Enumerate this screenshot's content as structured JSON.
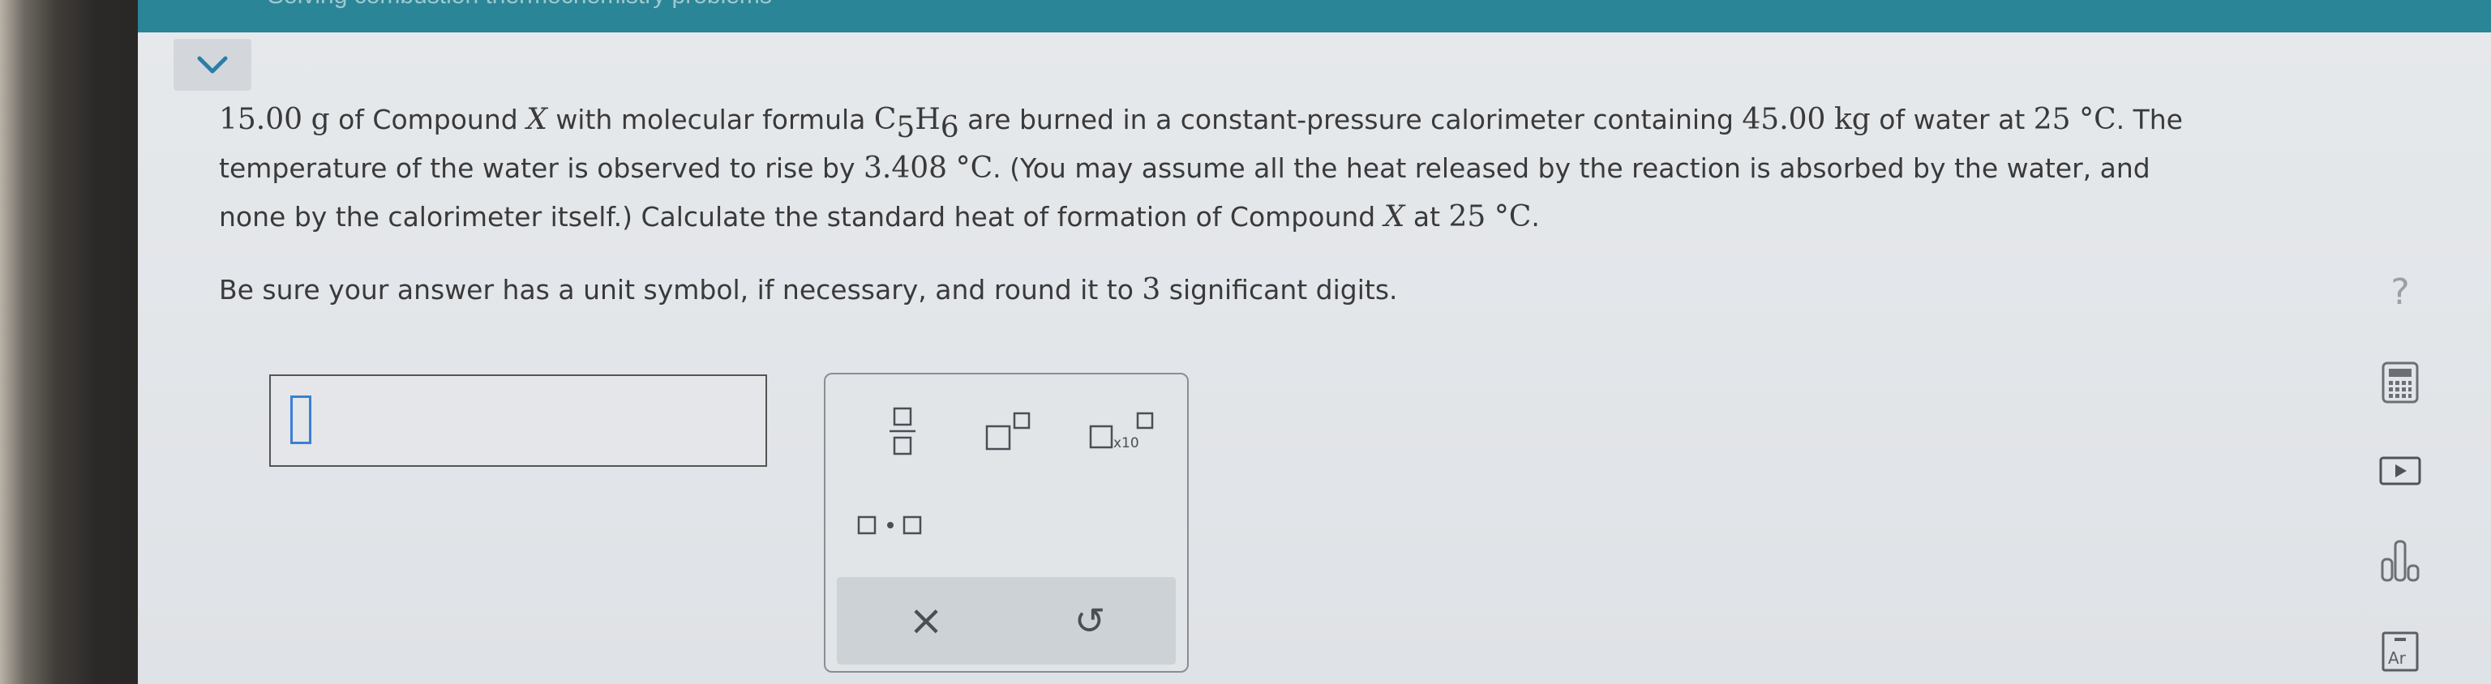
{
  "header": {
    "title": "Solving combustion thermochemistry problems"
  },
  "question": {
    "line1": {
      "mass": "15.00",
      "mass_unit": "g",
      "t1": " of Compound ",
      "compound_var": "X",
      "t2": " with molecular formula ",
      "formula_c": "C",
      "formula_c_sub": "5",
      "formula_h": "H",
      "formula_h_sub": "6",
      "t3": " are burned in a constant-pressure calorimeter containing ",
      "water_mass": "45.00",
      "water_unit": "kg",
      "t4": " of water at ",
      "temp": "25",
      "temp_unit": "°C",
      "t5": ". The"
    },
    "line2": {
      "t1": "temperature of the water is observed to rise by ",
      "rise": "3.408",
      "rise_unit": "°C",
      "t2": ". (You may assume all the heat released by the reaction is absorbed by the water, and"
    },
    "line3": {
      "t1": "none by the calorimeter itself.) Calculate the standard heat of formation of Compound ",
      "compound_var": "X",
      "t2": " at ",
      "temp": "25",
      "temp_unit": "°C",
      "t3": "."
    },
    "instruction": {
      "t1": "Be sure your answer has a unit symbol, if necessary, and round it to ",
      "digits": "3",
      "t2": " significant digits."
    }
  },
  "palette": {
    "x10_label": "x10",
    "clear_symbol": "×",
    "undo_symbol": "↺"
  },
  "right_icons": {
    "help": "?",
    "ar_label": "Ar"
  },
  "colors": {
    "topbar": "#2a8596",
    "cursor": "#3a7fd6",
    "text": "#3a3a3a"
  }
}
